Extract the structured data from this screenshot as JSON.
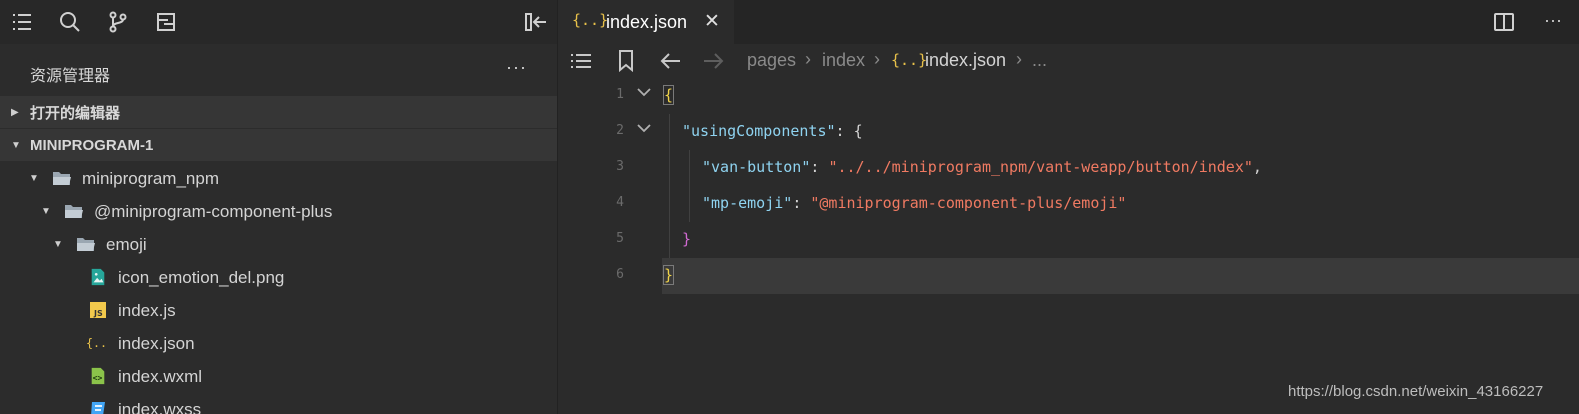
{
  "activity_bar": {
    "icons": [
      "list-icon",
      "search-icon",
      "source-control-icon",
      "debug-icon",
      "collapse-sidebar-icon"
    ]
  },
  "explorer": {
    "title": "资源管理器",
    "more": "···",
    "open_editors_label": "打开的编辑器",
    "project_label": "MINIPROGRAM-1",
    "tree": [
      {
        "label": "miniprogram_npm",
        "type": "folder"
      },
      {
        "label": "@miniprogram-component-plus",
        "type": "folder"
      },
      {
        "label": "emoji",
        "type": "folder"
      },
      {
        "label": "icon_emotion_del.png",
        "type": "image"
      },
      {
        "label": "index.js",
        "type": "js"
      },
      {
        "label": "index.json",
        "type": "json"
      },
      {
        "label": "index.wxml",
        "type": "wxml"
      },
      {
        "label": "index.wxss",
        "type": "wxss"
      }
    ]
  },
  "editor": {
    "tab": {
      "icon": "{..}",
      "label": "index.json",
      "close": "✕"
    },
    "more": "···",
    "breadcrumb": [
      "pages",
      "index",
      "index.json",
      "..."
    ],
    "breadcrumb_file_icon": "{..}",
    "lines": [
      {
        "num": "1",
        "text": "{"
      },
      {
        "num": "2",
        "key": "\"usingComponents\"",
        "rest": ": {"
      },
      {
        "num": "3",
        "key": "\"van-button\"",
        "value": "\"../../miniprogram_npm/vant-weapp/button/index\"",
        "tail": ","
      },
      {
        "num": "4",
        "key": "\"mp-emoji\"",
        "value": "\"@miniprogram-component-plus/emoji\"",
        "tail": ""
      },
      {
        "num": "5",
        "text": "}"
      },
      {
        "num": "6",
        "text": "}"
      }
    ]
  },
  "watermark": "https://blog.csdn.net/weixin_43166227",
  "colors": {
    "json_icon": "#e8c14a",
    "string": "#f07a62",
    "key": "#8fd3f0",
    "brace_outer": "#f0d34a",
    "brace_inner": "#d16ad2"
  }
}
